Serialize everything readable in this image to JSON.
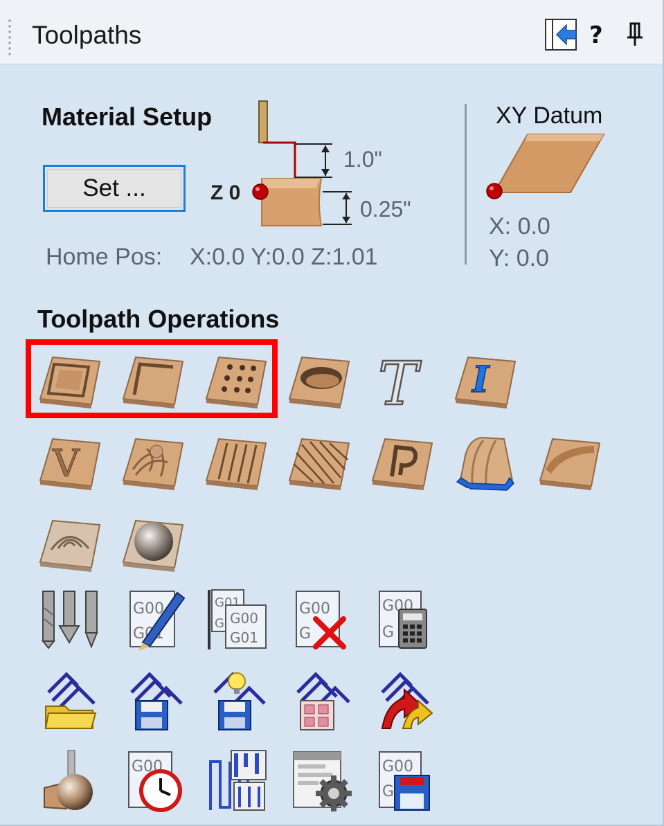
{
  "titlebar": {
    "title": "Toolpaths",
    "icons": [
      "panel-toggle-icon",
      "help-icon",
      "pin-icon"
    ]
  },
  "material_setup": {
    "heading": "Material Setup",
    "set_button": "Set ...",
    "z_zero_label": "Z 0",
    "safe_z": "1.0\"",
    "material_thickness": "0.25\"",
    "home_label": "Home Pos:",
    "home_value": "X:0.0 Y:0.0 Z:1.01"
  },
  "xy_datum": {
    "heading": "XY Datum",
    "x": "X: 0.0",
    "y": "Y: 0.0"
  },
  "toolpath_operations": {
    "heading": "Toolpath Operations",
    "rows": [
      [
        "profile-toolpath-icon",
        "pocket-toolpath-icon",
        "drilling-toolpath-icon",
        "quick-engrave-icon",
        "fluting-text-icon",
        "inlay-toolpath-icon"
      ],
      [
        "vcarve-toolpath-icon",
        "3d-roughing-icon",
        "fluting-toolpath-icon",
        "texture-toolpath-icon",
        "prism-carving-icon",
        "moulding-toolpath-icon",
        "chamfer-toolpath-icon"
      ],
      [
        "3d-finish-icon",
        "3d-rough-sphere-icon"
      ],
      [
        "tool-database-icon",
        "edit-gcode-icon",
        "merge-toolpaths-icon",
        "delete-gcode-icon",
        "toolpath-calculator-icon"
      ],
      [
        "open-template-icon",
        "save-template-icon",
        "template-tips-icon",
        "toolpath-grid-icon",
        "merge-templates-icon"
      ],
      [
        "preview-toolpath-icon",
        "time-estimate-icon",
        "nesting-icon",
        "toolpath-settings-icon",
        "save-gcode-icon"
      ]
    ]
  },
  "colors": {
    "panel_bg": "#d7e4f2",
    "highlight": "#ff0000",
    "accent_blue": "#1e7fd9",
    "wood": "#d8a880"
  }
}
